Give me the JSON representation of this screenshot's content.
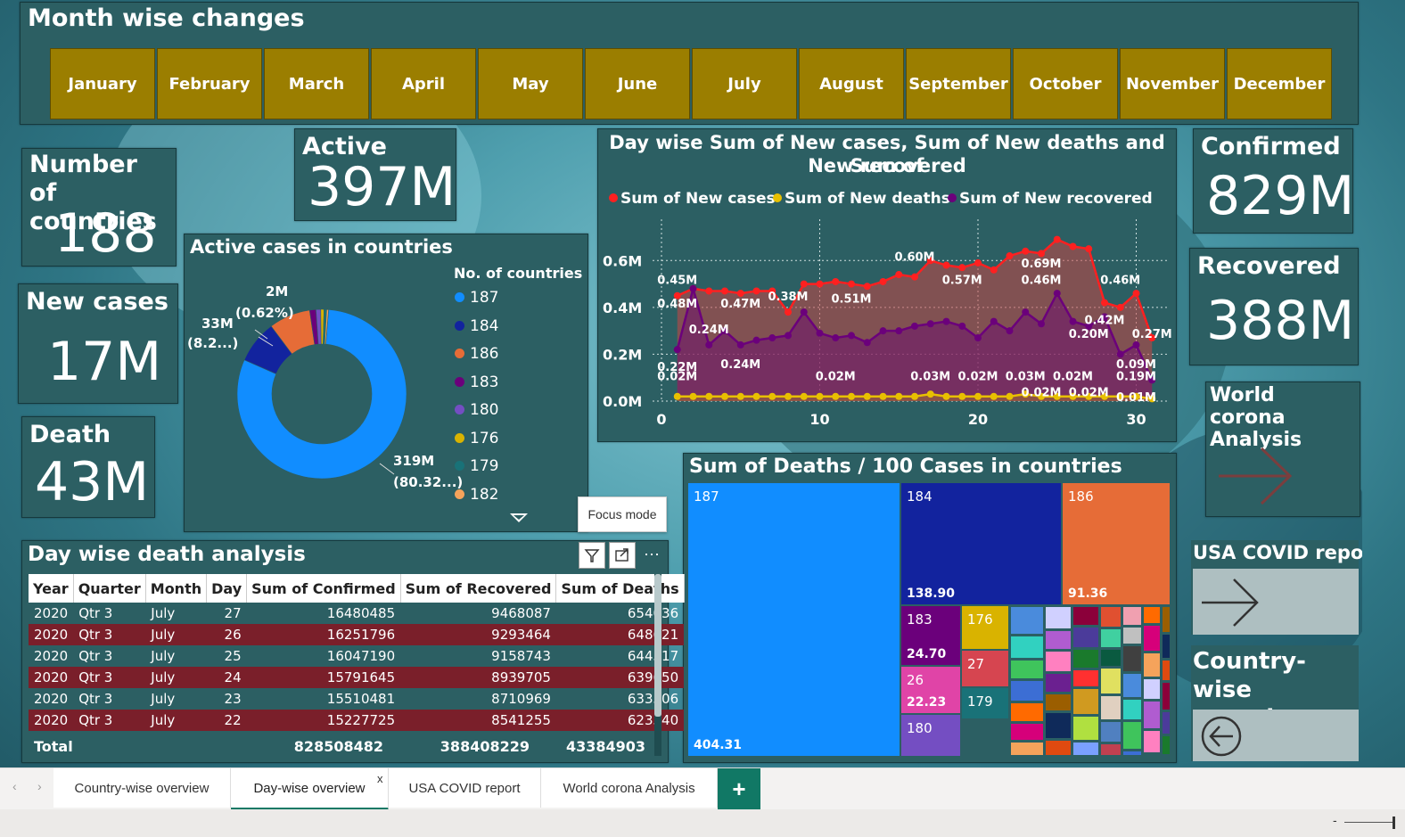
{
  "header": {
    "title": "Month wise changes",
    "months": [
      "January",
      "February",
      "March",
      "April",
      "May",
      "June",
      "July",
      "August",
      "September",
      "October",
      "November",
      "December"
    ]
  },
  "kpis": {
    "countries_label": "Number of countries",
    "countries_value": "188",
    "active_label": "Active",
    "active_value": "397M",
    "new_cases_label": "New cases",
    "new_cases_value": "17M",
    "death_label": "Death",
    "death_value": "43M",
    "confirmed_label": "Confirmed",
    "confirmed_value": "829M",
    "recovered_label": "Recovered",
    "recovered_value": "388M"
  },
  "nav": {
    "world_label": "World corona Analysis",
    "usa_label": "USA COVID report",
    "country_label": "Country-wise overview"
  },
  "donut": {
    "title": "Active cases in countries",
    "legend_title": "No. of countries",
    "label_large_val": "319M",
    "label_large_pct": "(80.32...)",
    "label_mid_val": "33M",
    "label_mid_pct": "(8.2...)",
    "label_small_val": "2M",
    "label_small_pct": "(0.62%)",
    "legend": [
      {
        "name": "187",
        "color": "#118dff"
      },
      {
        "name": "184",
        "color": "#12239e"
      },
      {
        "name": "186",
        "color": "#e66c37"
      },
      {
        "name": "183",
        "color": "#6b007b"
      },
      {
        "name": "180",
        "color": "#744ec2"
      },
      {
        "name": "176",
        "color": "#d9b300"
      },
      {
        "name": "179",
        "color": "#197278"
      },
      {
        "name": "182",
        "color": "#f5a35b"
      }
    ],
    "slices": [
      {
        "name": "187",
        "value": 80.32,
        "color": "#118dff"
      },
      {
        "name": "184",
        "value": 8.2,
        "color": "#12239e"
      },
      {
        "name": "186",
        "value": 7.9,
        "color": "#e66c37"
      },
      {
        "name": "183",
        "value": 1.2,
        "color": "#6b007b"
      },
      {
        "name": "180",
        "value": 0.9,
        "color": "#744ec2"
      },
      {
        "name": "176",
        "value": 0.62,
        "color": "#d9b300"
      },
      {
        "name": "179",
        "value": 0.5,
        "color": "#197278"
      },
      {
        "name": "182",
        "value": 0.36,
        "color": "#f5a35b"
      }
    ]
  },
  "line_chart": {
    "title_line1": "Day wise Sum of New cases, Sum of New deaths and Sum of",
    "title_line2": "New recovered",
    "legend": [
      {
        "name": "Sum of New cases",
        "color": "#ff2020"
      },
      {
        "name": "Sum of New deaths",
        "color": "#e8c000"
      },
      {
        "name": "Sum of New recovered",
        "color": "#6b007b"
      }
    ],
    "y_ticks": [
      "0.6M",
      "0.4M",
      "0.2M",
      "0.0M"
    ],
    "x_ticks": [
      "0",
      "10",
      "20",
      "30"
    ],
    "data_labels": [
      {
        "text": "0.60M",
        "x": 16,
        "y": 0.6
      },
      {
        "text": "0.45M",
        "x": 1,
        "y": 0.5
      },
      {
        "text": "0.38M",
        "x": 8,
        "y": 0.43
      },
      {
        "text": "0.51M",
        "x": 12,
        "y": 0.42
      },
      {
        "text": "0.57M",
        "x": 19,
        "y": 0.5
      },
      {
        "text": "0.69M",
        "x": 24,
        "y": 0.57
      },
      {
        "text": "0.46M",
        "x": 24,
        "y": 0.5
      },
      {
        "text": "0.46M",
        "x": 29,
        "y": 0.5
      },
      {
        "text": "0.48M",
        "x": 1,
        "y": 0.4
      },
      {
        "text": "0.47M",
        "x": 5,
        "y": 0.4
      },
      {
        "text": "0.24M",
        "x": 3,
        "y": 0.29
      },
      {
        "text": "0.42M",
        "x": 28,
        "y": 0.33
      },
      {
        "text": "0.20M",
        "x": 27,
        "y": 0.27
      },
      {
        "text": "0.27M",
        "x": 31,
        "y": 0.27
      },
      {
        "text": "0.22M",
        "x": 1,
        "y": 0.13
      },
      {
        "text": "0.02M",
        "x": 1,
        "y": 0.09
      },
      {
        "text": "0.24M",
        "x": 5,
        "y": 0.14
      },
      {
        "text": "0.02M",
        "x": 11,
        "y": 0.09
      },
      {
        "text": "0.03M",
        "x": 17,
        "y": 0.09
      },
      {
        "text": "0.02M",
        "x": 20,
        "y": 0.09
      },
      {
        "text": "0.03M",
        "x": 23,
        "y": 0.09
      },
      {
        "text": "0.02M",
        "x": 26,
        "y": 0.09
      },
      {
        "text": "0.09M",
        "x": 30,
        "y": 0.14
      },
      {
        "text": "0.19M",
        "x": 30,
        "y": 0.09
      },
      {
        "text": "0.02M",
        "x": 24,
        "y": 0.02
      },
      {
        "text": "0.02M",
        "x": 27,
        "y": 0.02
      },
      {
        "text": "0.01M",
        "x": 30,
        "y": 0.0
      }
    ]
  },
  "chart_data": {
    "type": "line",
    "title": "Day wise Sum of New cases, Sum of New deaths and Sum of New recovered",
    "xlim": [
      0,
      32
    ],
    "ylim": [
      0,
      0.7
    ],
    "grid": true,
    "legend_position": "top",
    "x": [
      1,
      2,
      3,
      4,
      5,
      6,
      7,
      8,
      9,
      10,
      11,
      12,
      13,
      14,
      15,
      16,
      17,
      18,
      19,
      20,
      21,
      22,
      23,
      24,
      25,
      26,
      27,
      28,
      29,
      30,
      31
    ],
    "series": [
      {
        "name": "Sum of New cases",
        "values": [
          0.45,
          0.48,
          0.47,
          0.47,
          0.46,
          0.47,
          0.47,
          0.38,
          0.5,
          0.5,
          0.51,
          0.5,
          0.49,
          0.51,
          0.54,
          0.53,
          0.6,
          0.58,
          0.57,
          0.59,
          0.56,
          0.62,
          0.64,
          0.63,
          0.69,
          0.66,
          0.65,
          0.42,
          0.4,
          0.46,
          0.27
        ]
      },
      {
        "name": "Sum of New deaths",
        "values": [
          0.02,
          0.02,
          0.02,
          0.02,
          0.02,
          0.02,
          0.02,
          0.02,
          0.02,
          0.02,
          0.02,
          0.02,
          0.02,
          0.02,
          0.02,
          0.02,
          0.03,
          0.02,
          0.02,
          0.02,
          0.02,
          0.02,
          0.03,
          0.02,
          0.02,
          0.02,
          0.02,
          0.02,
          0.02,
          0.02,
          0.01
        ]
      },
      {
        "name": "Sum of New recovered",
        "values": [
          0.22,
          0.48,
          0.24,
          0.3,
          0.24,
          0.26,
          0.27,
          0.28,
          0.38,
          0.29,
          0.27,
          0.28,
          0.25,
          0.3,
          0.3,
          0.32,
          0.33,
          0.34,
          0.32,
          0.27,
          0.34,
          0.3,
          0.38,
          0.33,
          0.46,
          0.34,
          0.32,
          0.36,
          0.2,
          0.24,
          0.09
        ]
      }
    ]
  },
  "treemap": {
    "title": "Sum of Deaths / 100 Cases in countries",
    "cells": [
      {
        "name": "187",
        "value": "404.31",
        "color": "#118dff"
      },
      {
        "name": "184",
        "value": "138.90",
        "color": "#12239e"
      },
      {
        "name": "186",
        "value": "91.36",
        "color": "#e66c37"
      },
      {
        "name": "183",
        "value": "24.70",
        "color": "#6b007b"
      },
      {
        "name": "176",
        "value": "",
        "color": "#d9b300"
      },
      {
        "name": "26",
        "value": "22.23",
        "color": "#e044a7"
      },
      {
        "name": "27",
        "value": "",
        "color": "#d64550"
      },
      {
        "name": "179",
        "value": "",
        "color": "#197278"
      },
      {
        "name": "180",
        "value": "",
        "color": "#744ec2"
      }
    ],
    "small_colors": [
      "#4a8bdc",
      "#31d1c0",
      "#3fc45c",
      "#3c6ed4",
      "#ff6a00",
      "#d6007a",
      "#f5a35b",
      "#d0d0ff",
      "#b05cd0",
      "#ff80c0",
      "#6b2090",
      "#9b5e00",
      "#0f2a5a",
      "#e04a10",
      "#8b003a",
      "#4b3b9a",
      "#1a7a2c",
      "#ff3030",
      "#d09a20",
      "#b0e040",
      "#7aa0ff",
      "#e05030",
      "#40d0a0",
      "#0a5a40",
      "#e0e060",
      "#e0d0c0",
      "#5080c0",
      "#c04050",
      "#f0a0b0",
      "#c0c0c0",
      "#404040"
    ]
  },
  "table": {
    "title": "Day wise death analysis",
    "columns": [
      "Year",
      "Quarter",
      "Month",
      "Day",
      "Sum of Confirmed",
      "Sum of Recovered",
      "Sum of Deaths"
    ],
    "rows": [
      [
        "2020",
        "Qtr 3",
        "July",
        "27",
        "16480485",
        "9468087",
        "654036"
      ],
      [
        "2020",
        "Qtr 3",
        "July",
        "26",
        "16251796",
        "9293464",
        "648621"
      ],
      [
        "2020",
        "Qtr 3",
        "July",
        "25",
        "16047190",
        "9158743",
        "644517"
      ],
      [
        "2020",
        "Qtr 3",
        "July",
        "24",
        "15791645",
        "8939705",
        "639650"
      ],
      [
        "2020",
        "Qtr 3",
        "July",
        "23",
        "15510481",
        "8710969",
        "633506"
      ],
      [
        "2020",
        "Qtr 3",
        "July",
        "22",
        "15227725",
        "8541255",
        "623540"
      ]
    ],
    "total_label": "Total",
    "total_confirmed": "828508482",
    "total_recovered": "388408229",
    "total_deaths": "43384903",
    "tooltip": "Focus mode"
  },
  "tabs": {
    "items": [
      "Country-wise overview",
      "Day-wise overview",
      "USA COVID report",
      "World corona Analysis"
    ],
    "active": "Day-wise overview",
    "close": "x",
    "add": "+"
  },
  "status": {
    "zoom_minus": "-"
  }
}
